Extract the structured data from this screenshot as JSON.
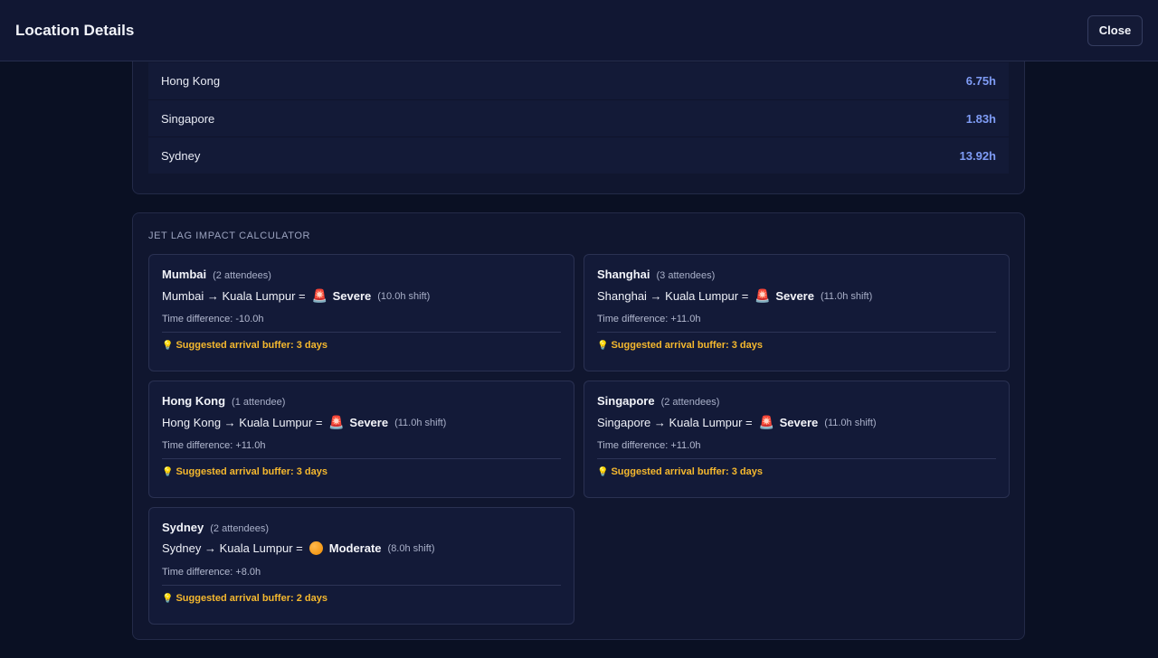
{
  "header": {
    "title": "Location Details",
    "close_label": "Close"
  },
  "timezone_rows": [
    {
      "city": "Hong Kong",
      "value": "6.75h"
    },
    {
      "city": "Singapore",
      "value": "1.83h"
    },
    {
      "city": "Sydney",
      "value": "13.92h"
    }
  ],
  "jet_lag": {
    "section_title": "JET LAG IMPACT CALCULATOR",
    "cards": [
      {
        "city": "Mumbai",
        "attendees": "(2 attendees)",
        "route": "Mumbai → Kuala Lumpur =",
        "severity_icon": "siren-icon",
        "severity": "Severe",
        "shift": "(10.0h shift)",
        "time_diff": "Time difference: -10.0h",
        "buffer": "Suggested arrival buffer: 3 days"
      },
      {
        "city": "Shanghai",
        "attendees": "(3 attendees)",
        "route": "Shanghai → Kuala Lumpur =",
        "severity_icon": "siren-icon",
        "severity": "Severe",
        "shift": "(11.0h shift)",
        "time_diff": "Time difference: +11.0h",
        "buffer": "Suggested arrival buffer: 3 days"
      },
      {
        "city": "Hong Kong",
        "attendees": "(1 attendee)",
        "route": "Hong Kong → Kuala Lumpur =",
        "severity_icon": "siren-icon",
        "severity": "Severe",
        "shift": "(11.0h shift)",
        "time_diff": "Time difference: +11.0h",
        "buffer": "Suggested arrival buffer: 3 days"
      },
      {
        "city": "Singapore",
        "attendees": "(2 attendees)",
        "route": "Singapore → Kuala Lumpur =",
        "severity_icon": "siren-icon",
        "severity": "Severe",
        "shift": "(11.0h shift)",
        "time_diff": "Time difference: +11.0h",
        "buffer": "Suggested arrival buffer: 3 days"
      },
      {
        "city": "Sydney",
        "attendees": "(2 attendees)",
        "route": "Sydney → Kuala Lumpur =",
        "severity_icon": "orange-circle-icon",
        "severity": "Moderate",
        "shift": "(8.0h shift)",
        "time_diff": "Time difference: +8.0h",
        "buffer": "Suggested arrival buffer: 2 days"
      }
    ]
  },
  "colors": {
    "background": "#0a1023",
    "accent_value": "#7f9cf5",
    "buffer_text": "#f5b82e",
    "severe": "#ef4444",
    "moderate": "#f08c00"
  }
}
